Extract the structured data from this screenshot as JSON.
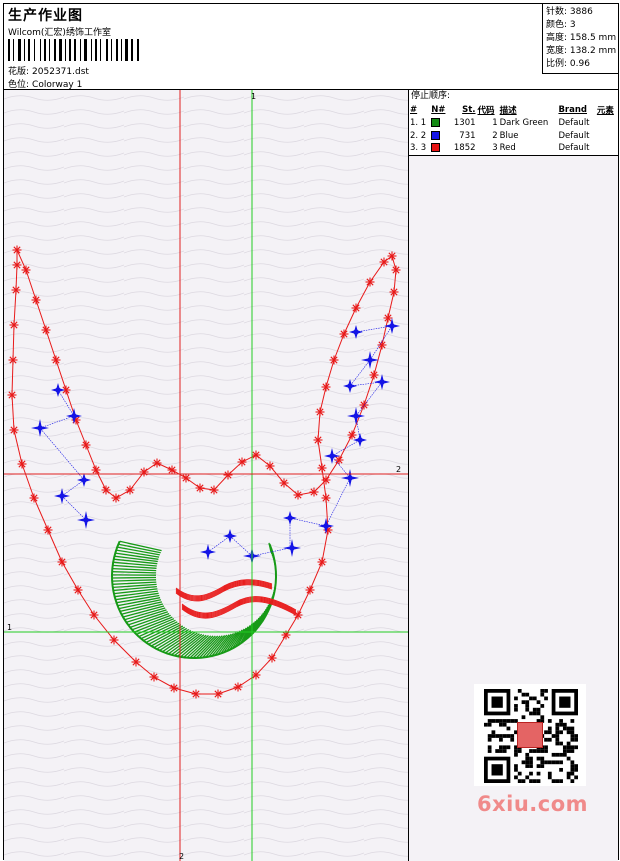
{
  "header": {
    "title": "生产作业图",
    "company": "Wilcom(汇宏)绣饰工作室",
    "design_label": "花版:",
    "design_value": "2052371.dst",
    "colorway_label": "色位:",
    "colorway_value": "Colorway 1"
  },
  "stats": {
    "stitches_label": "针数:",
    "stitches_value": "3886",
    "colors_label": "颜色:",
    "colors_value": "3",
    "height_label": "高度:",
    "height_value": "158.5 mm",
    "width_label": "宽度:",
    "width_value": "138.2 mm",
    "scale_label": "比例:",
    "scale_value": "0.96"
  },
  "guides": {
    "green_v": "1",
    "red_h": "2",
    "green_h": "1",
    "red_v": "2"
  },
  "color_table": {
    "stop_label": "停止顺序:",
    "columns": [
      "#",
      "N#",
      "St.",
      "代码",
      "描述",
      "Brand",
      "元素"
    ],
    "rows": [
      {
        "index": "1. 1",
        "color": "#138a13",
        "stitches": "1301",
        "code": "1",
        "description": "Dark Green",
        "brand": "Default"
      },
      {
        "index": "2. 2",
        "color": "#1414e6",
        "stitches": "731",
        "code": "2",
        "description": "Blue",
        "brand": "Default"
      },
      {
        "index": "3. 3",
        "color": "#e61414",
        "stitches": "1852",
        "code": "3",
        "description": "Red",
        "brand": "Default"
      }
    ]
  },
  "colors": {
    "red_thread": "#e81a1a",
    "blue_thread": "#1414e6",
    "green_thread": "#179a17",
    "guide_red": "#e02020",
    "guide_green": "#22cc22"
  },
  "watermark": "6xiu.com",
  "qr_icon": "qr-code-icon"
}
